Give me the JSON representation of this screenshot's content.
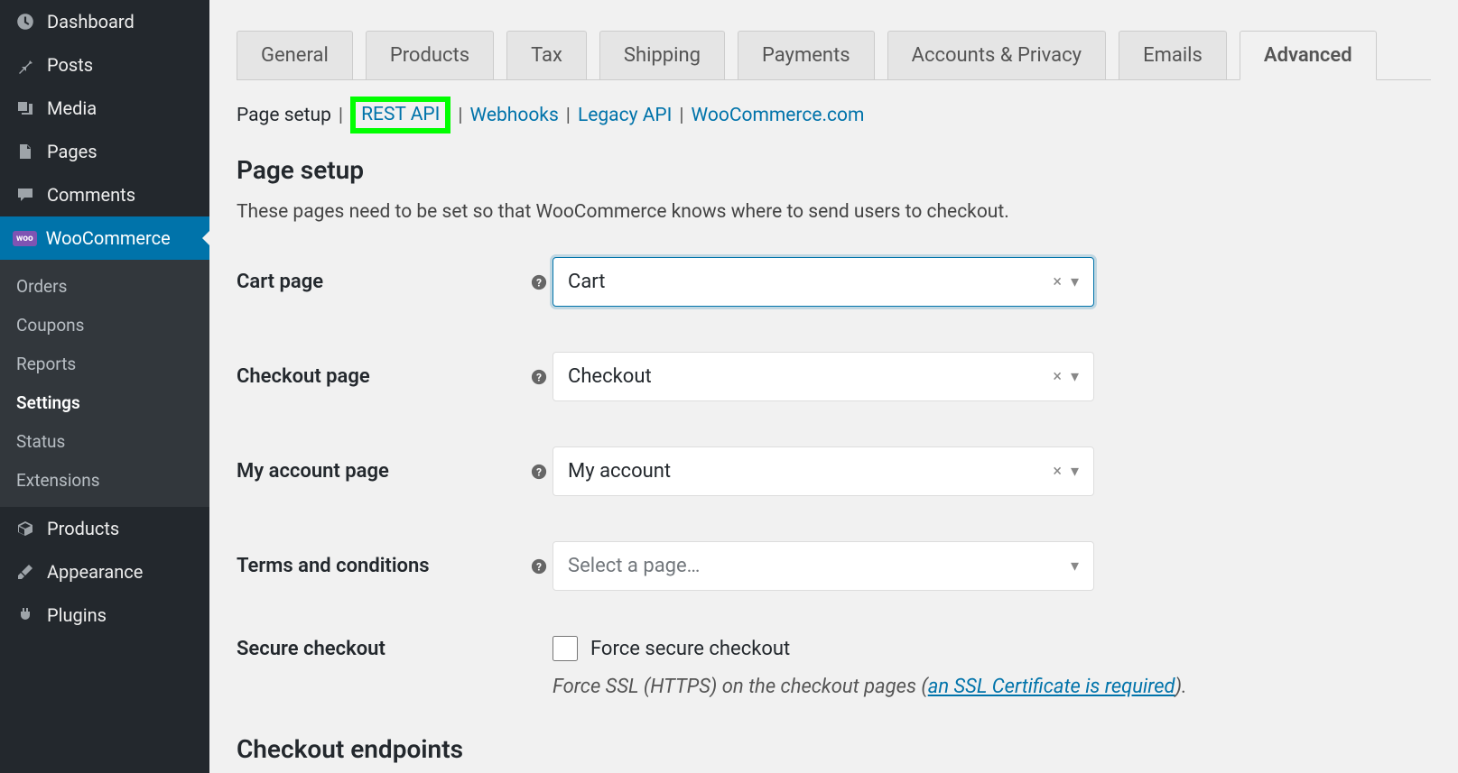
{
  "sidebar": {
    "top": [
      {
        "icon": "dashboard-icon",
        "label": "Dashboard"
      },
      {
        "icon": "pin-icon",
        "label": "Posts"
      },
      {
        "icon": "media-icon",
        "label": "Media"
      },
      {
        "icon": "page-icon",
        "label": "Pages"
      },
      {
        "icon": "comment-icon",
        "label": "Comments"
      }
    ],
    "woo": {
      "label": "WooCommerce",
      "badge": "woo"
    },
    "woo_sub": [
      {
        "label": "Orders"
      },
      {
        "label": "Coupons"
      },
      {
        "label": "Reports"
      },
      {
        "label": "Settings",
        "current": true
      },
      {
        "label": "Status"
      },
      {
        "label": "Extensions"
      }
    ],
    "bottom": [
      {
        "icon": "cube-icon",
        "label": "Products"
      },
      {
        "icon": "brush-icon",
        "label": "Appearance"
      },
      {
        "icon": "plug-icon",
        "label": "Plugins"
      }
    ]
  },
  "tabs": [
    {
      "label": "General"
    },
    {
      "label": "Products"
    },
    {
      "label": "Tax"
    },
    {
      "label": "Shipping"
    },
    {
      "label": "Payments"
    },
    {
      "label": "Accounts & Privacy"
    },
    {
      "label": "Emails"
    },
    {
      "label": "Advanced",
      "active": true
    }
  ],
  "subnav": {
    "items": [
      {
        "label": "Page setup",
        "current": true
      },
      {
        "label": "REST API",
        "highlight": true
      },
      {
        "label": "Webhooks"
      },
      {
        "label": "Legacy API"
      },
      {
        "label": "WooCommerce.com"
      }
    ]
  },
  "page_setup": {
    "title": "Page setup",
    "desc": "These pages need to be set so that WooCommerce knows where to send users to checkout.",
    "fields": {
      "cart": {
        "label": "Cart page",
        "value": "Cart",
        "focused": true
      },
      "checkout": {
        "label": "Checkout page",
        "value": "Checkout"
      },
      "account": {
        "label": "My account page",
        "value": "My account"
      },
      "terms": {
        "label": "Terms and conditions",
        "placeholder": "Select a page…"
      }
    },
    "secure": {
      "label": "Secure checkout",
      "checkbox_label": "Force secure checkout",
      "desc_before": "Force SSL (HTTPS) on the checkout pages (",
      "desc_link": "an SSL Certificate is required",
      "desc_after": ")."
    },
    "endpoints_title": "Checkout endpoints"
  }
}
